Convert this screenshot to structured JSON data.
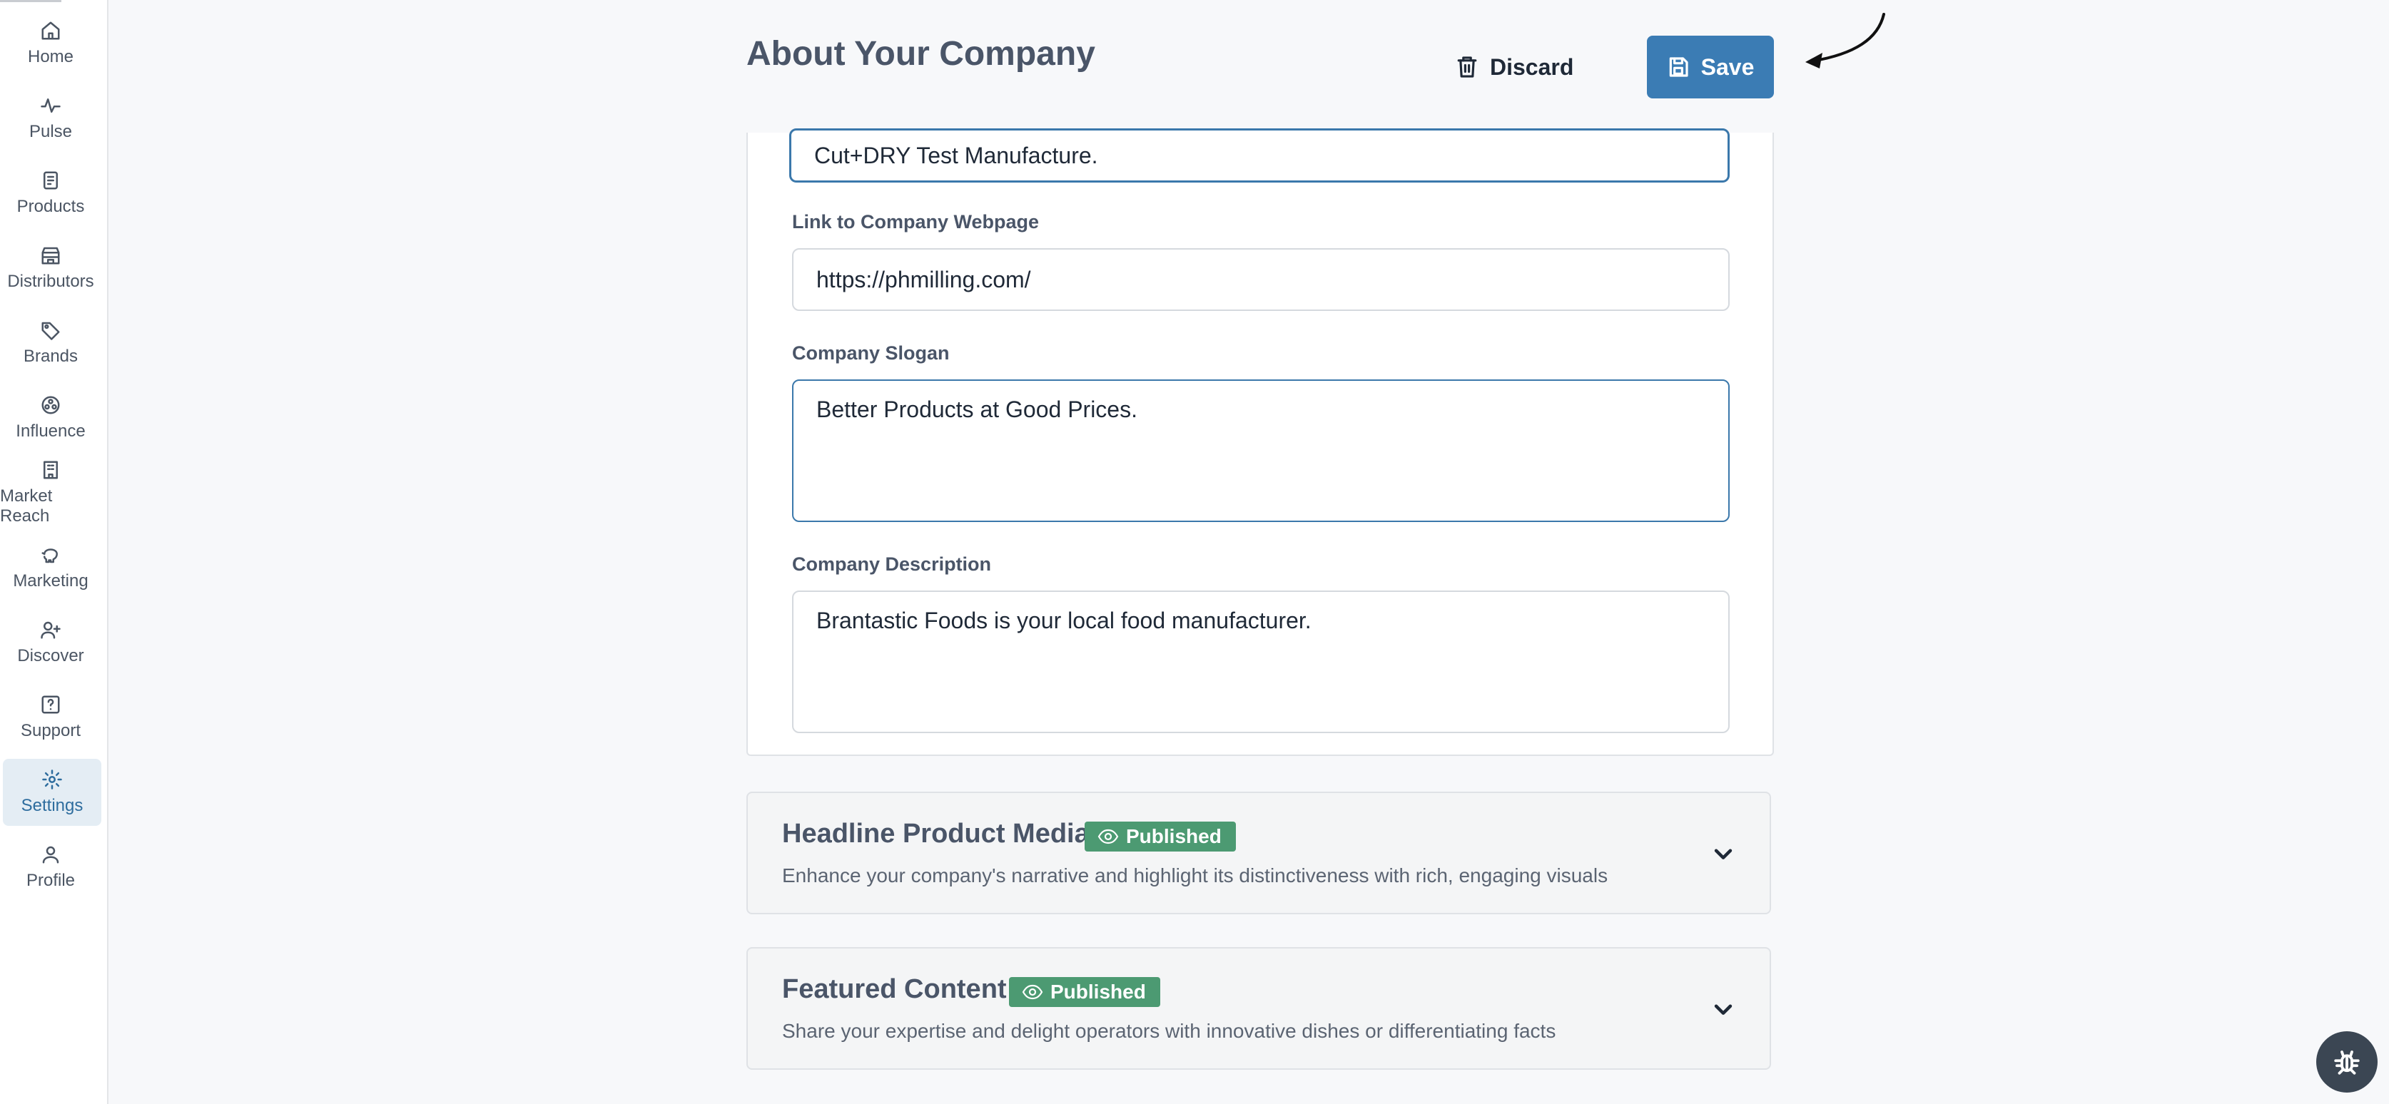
{
  "sidebar": {
    "items": [
      {
        "label": "Home",
        "icon": "home-icon"
      },
      {
        "label": "Pulse",
        "icon": "pulse-icon"
      },
      {
        "label": "Products",
        "icon": "products-icon"
      },
      {
        "label": "Distributors",
        "icon": "store-icon"
      },
      {
        "label": "Brands",
        "icon": "tag-icon"
      },
      {
        "label": "Influence",
        "icon": "influence-icon"
      },
      {
        "label": "Market Reach",
        "icon": "building-icon"
      },
      {
        "label": "Marketing",
        "icon": "piggy-bank-icon"
      },
      {
        "label": "Discover",
        "icon": "user-plus-icon"
      },
      {
        "label": "Support",
        "icon": "question-icon"
      },
      {
        "label": "Settings",
        "icon": "gear-icon",
        "active": true
      },
      {
        "label": "Profile",
        "icon": "user-icon"
      }
    ]
  },
  "header": {
    "title": "About Your Company",
    "discard_label": "Discard",
    "save_label": "Save"
  },
  "form": {
    "company_name_value": "Cut+DRY Test Manufacture.",
    "webpage": {
      "label": "Link to Company Webpage",
      "value": "https://phmilling.com/"
    },
    "slogan": {
      "label": "Company Slogan",
      "value": "Better Products at Good Prices."
    },
    "description": {
      "label": "Company Description",
      "value": "Brantastic Foods is your local food manufacturer."
    }
  },
  "sections": [
    {
      "title": "Headline Product Media",
      "badge": "Published",
      "description": "Enhance your company's narrative and highlight its distinctiveness with rich, engaging visuals"
    },
    {
      "title": "Featured Content",
      "badge": "Published",
      "description": "Share your expertise and delight operators with innovative dishes or differentiating facts"
    }
  ],
  "colors": {
    "primary": "#3b7cb4",
    "published_badge": "#4c9a72",
    "active_nav_bg": "#e4edf4"
  }
}
